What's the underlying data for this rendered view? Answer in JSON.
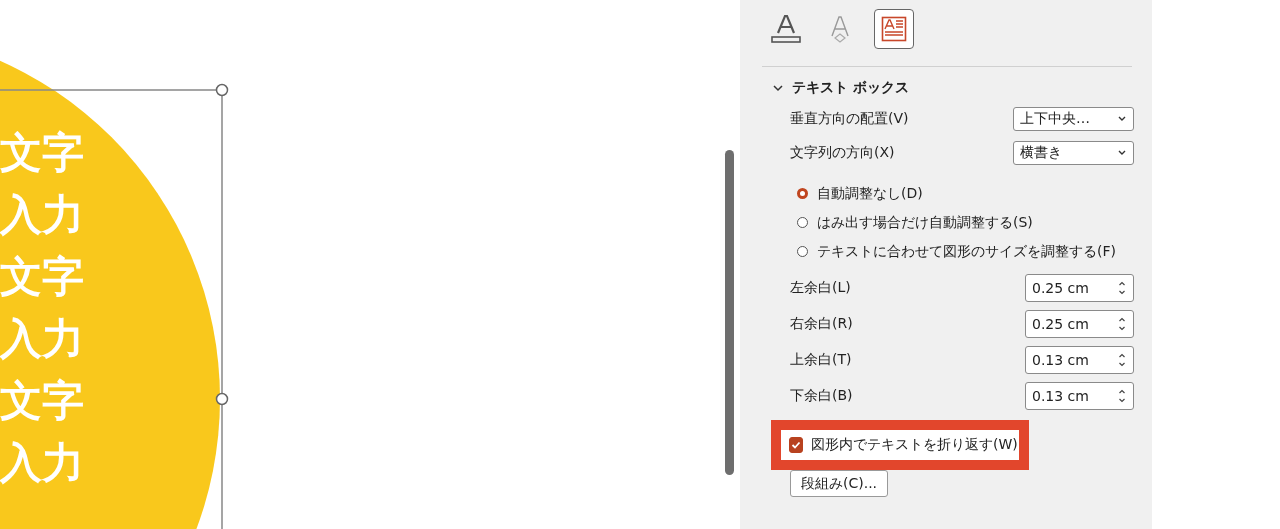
{
  "slide": {
    "text_lines": [
      "文字",
      "入力",
      "文字",
      "入力",
      "文字",
      "入力"
    ]
  },
  "panel": {
    "tabs": [
      {
        "kind": "fill-line",
        "selected": false
      },
      {
        "kind": "effects",
        "selected": false
      },
      {
        "kind": "textbox",
        "selected": true
      }
    ],
    "section": {
      "title": "テキスト ボックス",
      "expanded": true
    },
    "dropdowns": [
      {
        "label": "垂直方向の配置(V)",
        "value": "上下中央…"
      },
      {
        "label": "文字列の方向(X)",
        "value": "横書き"
      }
    ],
    "autofit": [
      {
        "label": "自動調整なし(D)",
        "selected": true
      },
      {
        "label": "はみ出す場合だけ自動調整する(S)",
        "selected": false
      },
      {
        "label": "テキストに合わせて図形のサイズを調整する(F)",
        "selected": false
      }
    ],
    "margins": [
      {
        "label": "左余白(L)",
        "value": "0.25 cm"
      },
      {
        "label": "右余白(R)",
        "value": "0.25 cm"
      },
      {
        "label": "上余白(T)",
        "value": "0.13 cm"
      },
      {
        "label": "下余白(B)",
        "value": "0.13 cm"
      }
    ],
    "wrap": {
      "label": "図形内でテキストを折り返す(W)",
      "checked": true,
      "highlighted": true
    },
    "columns_button": "段組み(C)..."
  }
}
